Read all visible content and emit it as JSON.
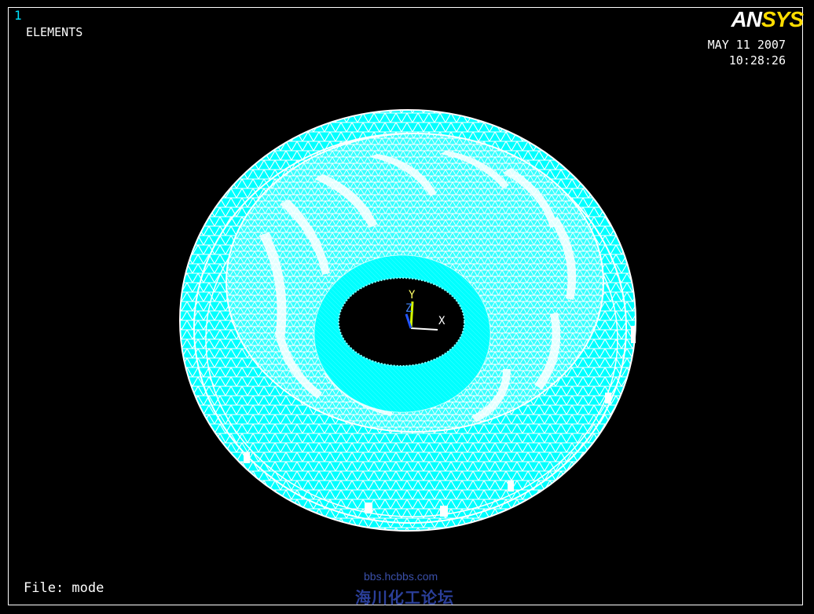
{
  "window": {
    "number": "1",
    "plot_type": "ELEMENTS",
    "date": "MAY 11 2007",
    "time": "10:28:26",
    "file_label": "File: mode"
  },
  "logo": {
    "part1": "AN",
    "part2": "SYS"
  },
  "triad": {
    "x_label": "X",
    "y_label": "Y",
    "z_label": "Z"
  },
  "watermark": {
    "url": "bbs.hcbbs.com",
    "name": "海川化工论坛"
  },
  "colors": {
    "background": "#000000",
    "mesh_fill": "#00ffff",
    "mesh_lines": "#ffffff",
    "logo_accent": "#ffdd00",
    "window_number": "#00e5ff"
  }
}
